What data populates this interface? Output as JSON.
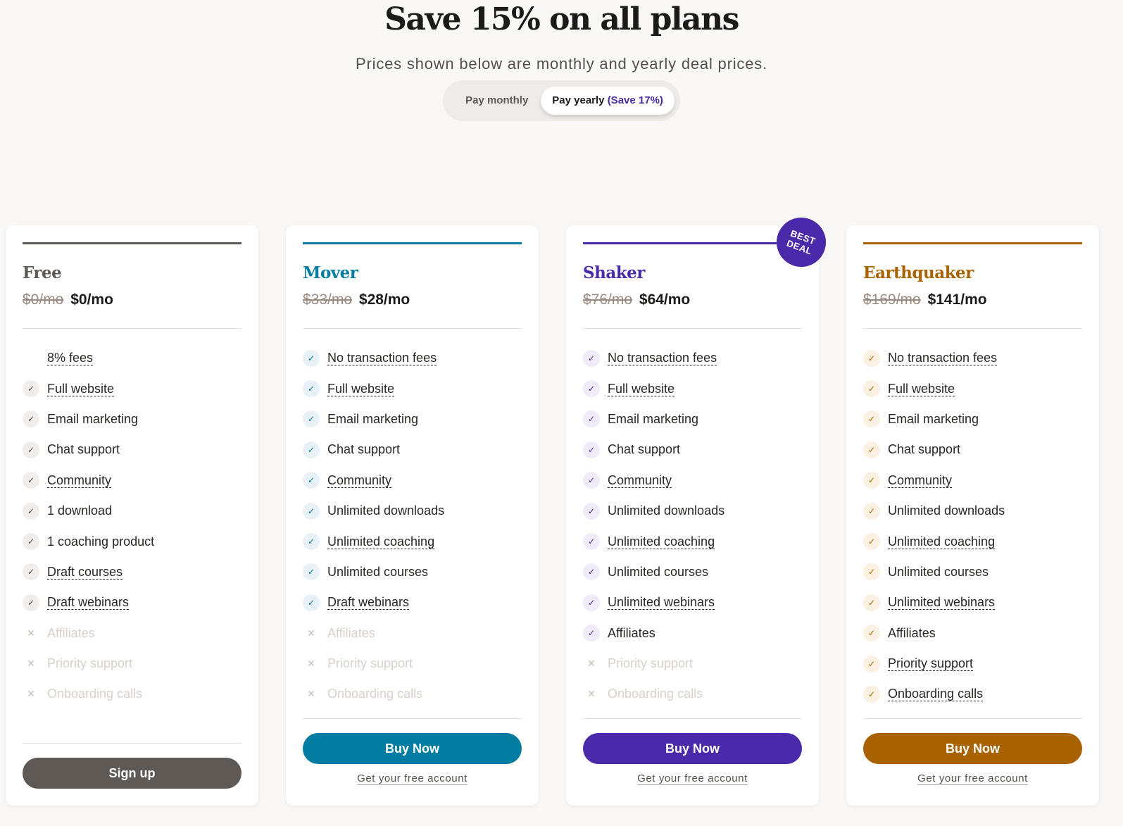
{
  "hero": {
    "title": "Save 15% on all plans",
    "subtitle": "Prices shown below are monthly and yearly deal prices.",
    "toggle": {
      "monthly_label": "Pay monthly",
      "yearly_label": "Pay yearly",
      "yearly_save": "(Save 17%)",
      "selected": "yearly"
    }
  },
  "plans": [
    {
      "name": "Free",
      "color": "#5e5955",
      "check_bg": "#f1edea",
      "check_color": "#55504c",
      "old_price": "$0/mo",
      "new_price": "$0/mo",
      "features": [
        {
          "label": "8% fees",
          "state": "none",
          "dotted": true
        },
        {
          "label": "Full website",
          "state": "yes",
          "dotted": true
        },
        {
          "label": "Email marketing",
          "state": "yes",
          "dotted": false
        },
        {
          "label": "Chat support",
          "state": "yes",
          "dotted": false
        },
        {
          "label": "Community",
          "state": "yes",
          "dotted": true
        },
        {
          "label": "1 download",
          "state": "yes",
          "dotted": false
        },
        {
          "label": "1 coaching product",
          "state": "yes",
          "dotted": false
        },
        {
          "label": "Draft courses",
          "state": "yes",
          "dotted": true
        },
        {
          "label": "Draft webinars",
          "state": "yes",
          "dotted": true
        },
        {
          "label": "Affiliates",
          "state": "no",
          "dotted": false
        },
        {
          "label": "Priority support",
          "state": "no",
          "dotted": false
        },
        {
          "label": "Onboarding calls",
          "state": "no",
          "dotted": false
        }
      ],
      "cta_label": "Sign up",
      "cta_color": "#5e5955",
      "free_link": ""
    },
    {
      "name": "Mover",
      "color": "#037ca1",
      "check_bg": "#e8f2f6",
      "check_color": "#037ca1",
      "old_price": "$33/mo",
      "new_price": "$28/mo",
      "features": [
        {
          "label": "No transaction fees",
          "state": "yes",
          "dotted": true
        },
        {
          "label": "Full website",
          "state": "yes",
          "dotted": true
        },
        {
          "label": "Email marketing",
          "state": "yes",
          "dotted": false
        },
        {
          "label": "Chat support",
          "state": "yes",
          "dotted": false
        },
        {
          "label": "Community",
          "state": "yes",
          "dotted": true
        },
        {
          "label": "Unlimited downloads",
          "state": "yes",
          "dotted": false
        },
        {
          "label": "Unlimited coaching",
          "state": "yes",
          "dotted": true
        },
        {
          "label": "Unlimited courses",
          "state": "yes",
          "dotted": false
        },
        {
          "label": "Draft webinars",
          "state": "yes",
          "dotted": true
        },
        {
          "label": "Affiliates",
          "state": "no",
          "dotted": false
        },
        {
          "label": "Priority support",
          "state": "no",
          "dotted": false
        },
        {
          "label": "Onboarding calls",
          "state": "no",
          "dotted": false
        }
      ],
      "cta_label": "Buy Now",
      "cta_color": "#037ca1",
      "free_link": "Get your free account"
    },
    {
      "name": "Shaker",
      "color": "#4a2aa8",
      "check_bg": "#efebf8",
      "check_color": "#4a2aa8",
      "old_price": "$76/mo",
      "new_price": "$64/mo",
      "badge": "BEST DEAL",
      "features": [
        {
          "label": "No transaction fees",
          "state": "yes",
          "dotted": true
        },
        {
          "label": "Full website",
          "state": "yes",
          "dotted": true
        },
        {
          "label": "Email marketing",
          "state": "yes",
          "dotted": false
        },
        {
          "label": "Chat support",
          "state": "yes",
          "dotted": false
        },
        {
          "label": "Community",
          "state": "yes",
          "dotted": true
        },
        {
          "label": "Unlimited downloads",
          "state": "yes",
          "dotted": false
        },
        {
          "label": "Unlimited coaching",
          "state": "yes",
          "dotted": true
        },
        {
          "label": "Unlimited courses",
          "state": "yes",
          "dotted": false
        },
        {
          "label": "Unlimited webinars",
          "state": "yes",
          "dotted": true
        },
        {
          "label": "Affiliates",
          "state": "yes",
          "dotted": false
        },
        {
          "label": "Priority support",
          "state": "no",
          "dotted": false
        },
        {
          "label": "Onboarding calls",
          "state": "no",
          "dotted": false
        }
      ],
      "cta_label": "Buy Now",
      "cta_color": "#4a2aa8",
      "free_link": "Get your free account"
    },
    {
      "name": "Earthquaker",
      "color": "#a86300",
      "check_bg": "#fbf0e2",
      "check_color": "#a86300",
      "old_price": "$169/mo",
      "new_price": "$141/mo",
      "features": [
        {
          "label": "No transaction fees",
          "state": "yes",
          "dotted": true
        },
        {
          "label": "Full website",
          "state": "yes",
          "dotted": true
        },
        {
          "label": "Email marketing",
          "state": "yes",
          "dotted": false
        },
        {
          "label": "Chat support",
          "state": "yes",
          "dotted": false
        },
        {
          "label": "Community",
          "state": "yes",
          "dotted": true
        },
        {
          "label": "Unlimited downloads",
          "state": "yes",
          "dotted": false
        },
        {
          "label": "Unlimited coaching",
          "state": "yes",
          "dotted": true
        },
        {
          "label": "Unlimited courses",
          "state": "yes",
          "dotted": false
        },
        {
          "label": "Unlimited webinars",
          "state": "yes",
          "dotted": true
        },
        {
          "label": "Affiliates",
          "state": "yes",
          "dotted": false
        },
        {
          "label": "Priority support",
          "state": "yes",
          "dotted": true
        },
        {
          "label": "Onboarding calls",
          "state": "yes",
          "dotted": true
        }
      ],
      "cta_label": "Buy Now",
      "cta_color": "#a86300",
      "free_link": "Get your free account"
    }
  ]
}
